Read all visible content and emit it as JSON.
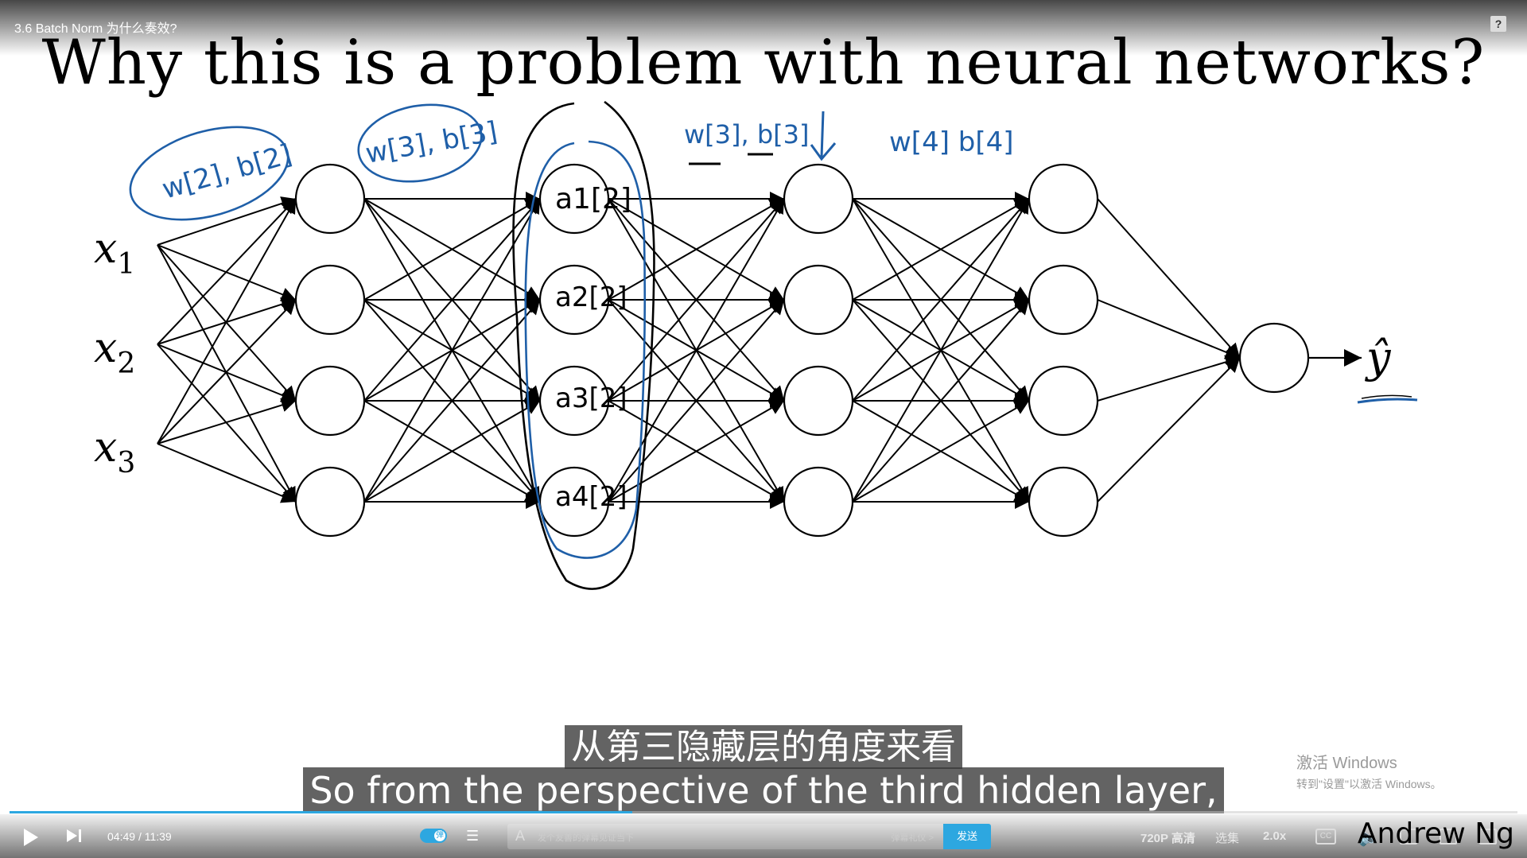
{
  "video": {
    "title": "3.6 Batch Norm 为什么奏效?",
    "help_label": "?"
  },
  "slide": {
    "heading": "Why this is a problem with neural networks?",
    "inputs": [
      "x",
      "x",
      "x"
    ],
    "input_subscripts": [
      "1",
      "2",
      "3"
    ],
    "output": "ŷ",
    "annotations": {
      "layer2_params": "w[2], b[2]",
      "layer3_params": "w[3], b[3]",
      "layer3_params_right": "w[3], b[3]",
      "layer4_params": "w[4] b[4]",
      "node_labels": [
        "a1[2]",
        "a2[2]",
        "a3[2]",
        "a4[2]"
      ]
    },
    "author": "Andrew Ng"
  },
  "subtitles": {
    "chinese": "从第三隐藏层的角度来看",
    "english": "So from the perspective of the third hidden layer,"
  },
  "windows_watermark": {
    "line1": "激活 Windows",
    "line2": "转到\"设置\"以激活 Windows。"
  },
  "player": {
    "current_time": "04:49",
    "separator": "/",
    "duration": "11:39",
    "progress_fraction": 0.413,
    "danmaku_toggle_label": "弹",
    "danmaku_placeholder": "发个友善的弹幕见证当下",
    "danmaku_etiquette": "弹幕礼仪 >",
    "send_label": "发送",
    "quality": "720P 高清",
    "episodes": "选集",
    "speed": "2.0x",
    "cc_label": "CC",
    "accent_color": "#2da7e0"
  },
  "colors": {
    "ink": "#000000",
    "pen_blue": "#1f5fa8"
  }
}
